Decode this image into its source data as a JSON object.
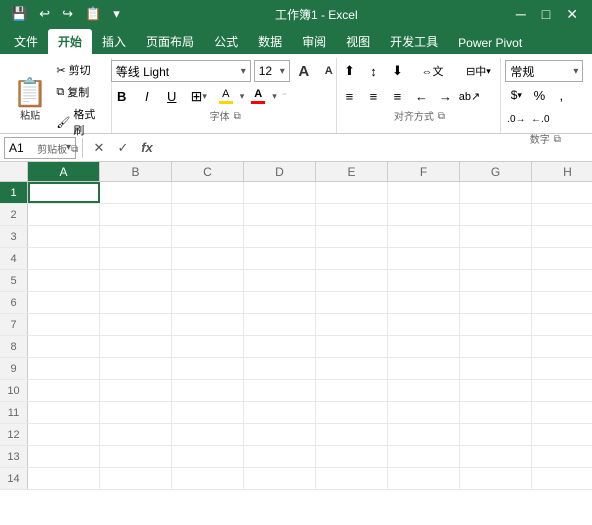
{
  "titlebar": {
    "title": "工作簿1 - Excel",
    "save_icon": "💾",
    "undo_icon": "↩",
    "redo_icon": "↪",
    "quickaccess_icon": "📋",
    "dropdown_icon": "▾"
  },
  "tabs": [
    {
      "label": "文件",
      "active": false
    },
    {
      "label": "开始",
      "active": true
    },
    {
      "label": "插入",
      "active": false
    },
    {
      "label": "页面布局",
      "active": false
    },
    {
      "label": "公式",
      "active": false
    },
    {
      "label": "数据",
      "active": false
    },
    {
      "label": "审阅",
      "active": false
    },
    {
      "label": "视图",
      "active": false
    },
    {
      "label": "开发工具",
      "active": false
    },
    {
      "label": "Power Pivot",
      "active": false
    }
  ],
  "ribbon": {
    "clipboard_label": "剪贴板",
    "font_label": "字体",
    "align_label": "对齐方式",
    "number_label": "数字",
    "paste_label": "粘贴",
    "cut_label": "剪切",
    "copy_label": "复制",
    "format_paint_label": "格式刷",
    "font_name": "等线 Light",
    "font_size": "12",
    "font_grow": "A",
    "font_shrink": "A",
    "bold": "B",
    "italic": "I",
    "underline": "U",
    "borders": "⊞",
    "fill_color": "A",
    "font_color": "A",
    "align_top": "≡",
    "align_mid": "≡",
    "align_bot": "≡",
    "wrap_text": "⇔",
    "merge_center": "⊟",
    "align_left": "≡",
    "align_center": "≡",
    "align_right": "≡",
    "decrease_indent": "←",
    "increase_indent": "→",
    "num_format": "常规",
    "percent": "%",
    "comma": ",",
    "dec_increase": "+.0",
    "dec_decrease": "-.0"
  },
  "formula_bar": {
    "cell_ref": "A1",
    "cancel_icon": "✕",
    "confirm_icon": "✓",
    "fx_icon": "fx",
    "formula_value": ""
  },
  "columns": [
    "A",
    "B",
    "C",
    "D",
    "E",
    "F",
    "G",
    "H"
  ],
  "rows": [
    "1",
    "2",
    "3",
    "4",
    "5",
    "6",
    "7",
    "8",
    "9",
    "10",
    "11",
    "12",
    "13",
    "14"
  ],
  "active_cell": {
    "row": 0,
    "col": 0
  }
}
